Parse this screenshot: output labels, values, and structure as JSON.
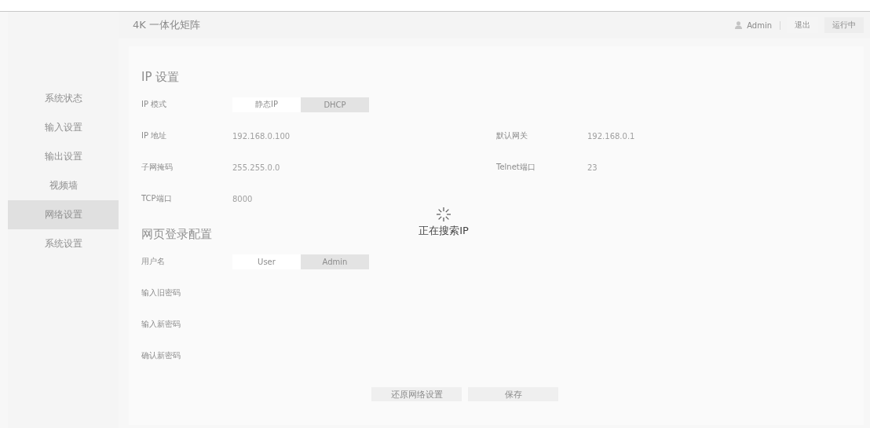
{
  "header": {
    "title": "4K 一体化矩阵",
    "user": "Admin",
    "logout": "退出",
    "status": "运行中"
  },
  "sidebar": {
    "items": [
      {
        "label": "系统状态",
        "selected": false
      },
      {
        "label": "输入设置",
        "selected": false
      },
      {
        "label": "输出设置",
        "selected": false
      },
      {
        "label": "视频墙",
        "selected": false
      },
      {
        "label": "网络设置",
        "selected": true
      },
      {
        "label": "系统设置",
        "selected": false
      }
    ]
  },
  "ip_section": {
    "title": "IP 设置",
    "mode_label": "IP 模式",
    "modes": [
      {
        "label": "静态IP",
        "selected": true
      },
      {
        "label": "DHCP",
        "selected": false
      }
    ],
    "fields": [
      {
        "label": "IP 地址",
        "value": "192.168.0.100"
      },
      {
        "label": "默认网关",
        "value": "192.168.0.1"
      },
      {
        "label": "子网掩码",
        "value": "255.255.0.0"
      },
      {
        "label": "Telnet端口",
        "value": "23"
      },
      {
        "label": "TCP端口",
        "value": "8000"
      }
    ]
  },
  "login_section": {
    "title": "网页登录配置",
    "user_label": "用户名",
    "users": [
      {
        "label": "User",
        "selected": true
      },
      {
        "label": "Admin",
        "selected": false
      }
    ],
    "password_labels": [
      "输入旧密码",
      "输入新密码",
      "确认新密码"
    ]
  },
  "buttons": [
    "还原网络设置",
    "保存"
  ],
  "loading": {
    "text": "正在搜索IP"
  }
}
